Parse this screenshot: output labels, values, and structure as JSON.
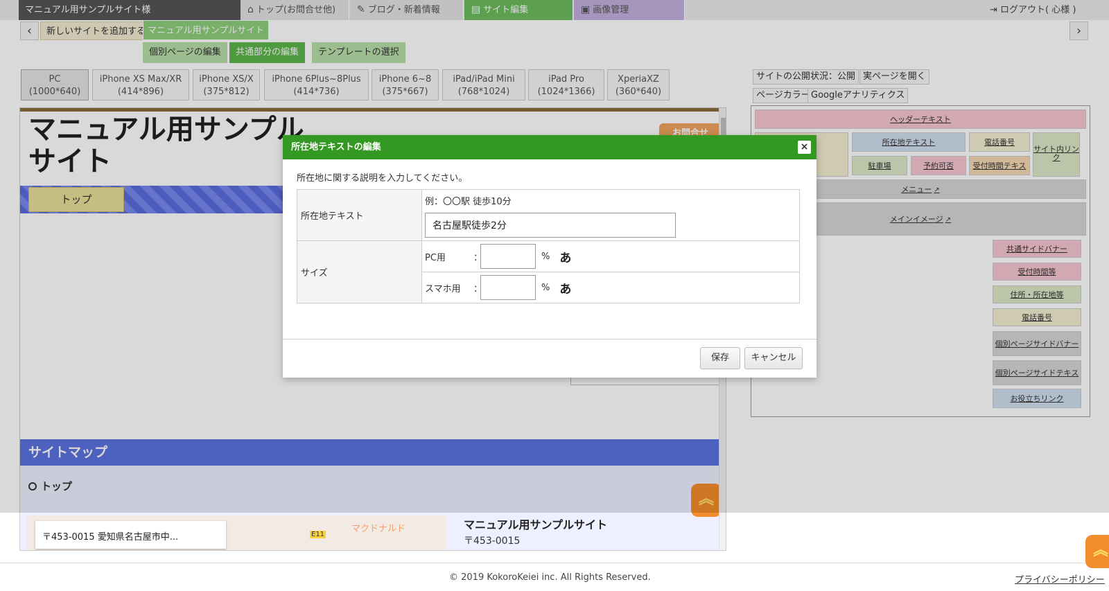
{
  "topnav": {
    "site_name": "マニュアル用サンプルサイト様",
    "items": [
      {
        "label": "トップ(お問合せ他)",
        "icon": "home-icon"
      },
      {
        "label": "ブログ・新着情報",
        "icon": "pen-icon"
      },
      {
        "label": "サイト編集",
        "icon": "document-icon"
      },
      {
        "label": "画像管理",
        "icon": "image-icon"
      }
    ],
    "logout": "ログアウト( 心様 )"
  },
  "site_bar": {
    "add_site": "新しいサイトを追加する",
    "current_site": "マニュアル用サンプルサイト",
    "subtabs": [
      "個別ページの編集",
      "共通部分の編集",
      "テンプレートの選択"
    ]
  },
  "devices": [
    {
      "name": "PC",
      "size": "(1000*640)"
    },
    {
      "name": "iPhone XS Max/XR",
      "size": "(414*896)"
    },
    {
      "name": "iPhone XS/X",
      "size": "(375*812)"
    },
    {
      "name": "iPhone 6Plus~8Plus",
      "size": "(414*736)"
    },
    {
      "name": "iPhone 6~8",
      "size": "(375*667)"
    },
    {
      "name": "iPad/iPad Mini",
      "size": "(768*1024)"
    },
    {
      "name": "iPad Pro",
      "size": "(1024*1366)"
    },
    {
      "name": "XperiaXZ",
      "size": "(360*640)"
    }
  ],
  "preview": {
    "site_title": "マニュアル用サンプルサイト",
    "contact_button": "お問合せ",
    "nav_top": "トップ",
    "sitemap_heading": "サイトマップ",
    "sitemap_top": "トップ",
    "map_address": "〒453-0015 愛知県名古屋市中...",
    "map_poi": "マクドナルド",
    "map_road": "E11",
    "footer_name": "マニュアル用サンプルサイト",
    "footer_zip": "〒453-0015"
  },
  "right_panel": {
    "buttons": [
      "サイトの公開状況：公開",
      "実ページを開く",
      "ページカラー",
      "Googleアナリティクス"
    ],
    "layout": {
      "header_text": "ヘッダーテキスト",
      "location_text": "所在地テキスト",
      "phone": "電話番号",
      "site_link": "サイト内リンク",
      "parking": "駐車場",
      "reservation": "予約可否",
      "reception_text": "受付時間テキスト",
      "menu": "メニュー",
      "main_image": "メインイメージ",
      "common_banner": "共通サイドバナー",
      "reception_hours": "受付時間等",
      "address": "住所・所在地等",
      "phone2": "電話番号",
      "page_banner": "個別ページサイドバナー",
      "page_text": "個別ページサイドテキスト",
      "useful_links": "お役立ちリンク"
    }
  },
  "modal": {
    "title": "所在地テキストの編集",
    "description": "所在地に関する説明を入力してください。",
    "location_label": "所在地テキスト",
    "example": "例：〇〇駅  徒歩10分",
    "location_value": "名古屋駅徒歩2分",
    "size_label": "サイズ",
    "pc_label": "PC用",
    "sp_label": "スマホ用",
    "colon": "：",
    "percent": "%",
    "a_glyph": "あ",
    "save": "保存",
    "cancel": "キャンセル"
  },
  "footer": {
    "copyright": "© 2019 KokoroKeiei inc. All Rights Reserved.",
    "privacy": "プライバシーポリシー"
  },
  "colors": {
    "accent_green": "#339922",
    "site_edit_tab": "#6cbb5d",
    "image_tab": "#c4b1e0",
    "sitemap_blue": "#5b72e0"
  }
}
